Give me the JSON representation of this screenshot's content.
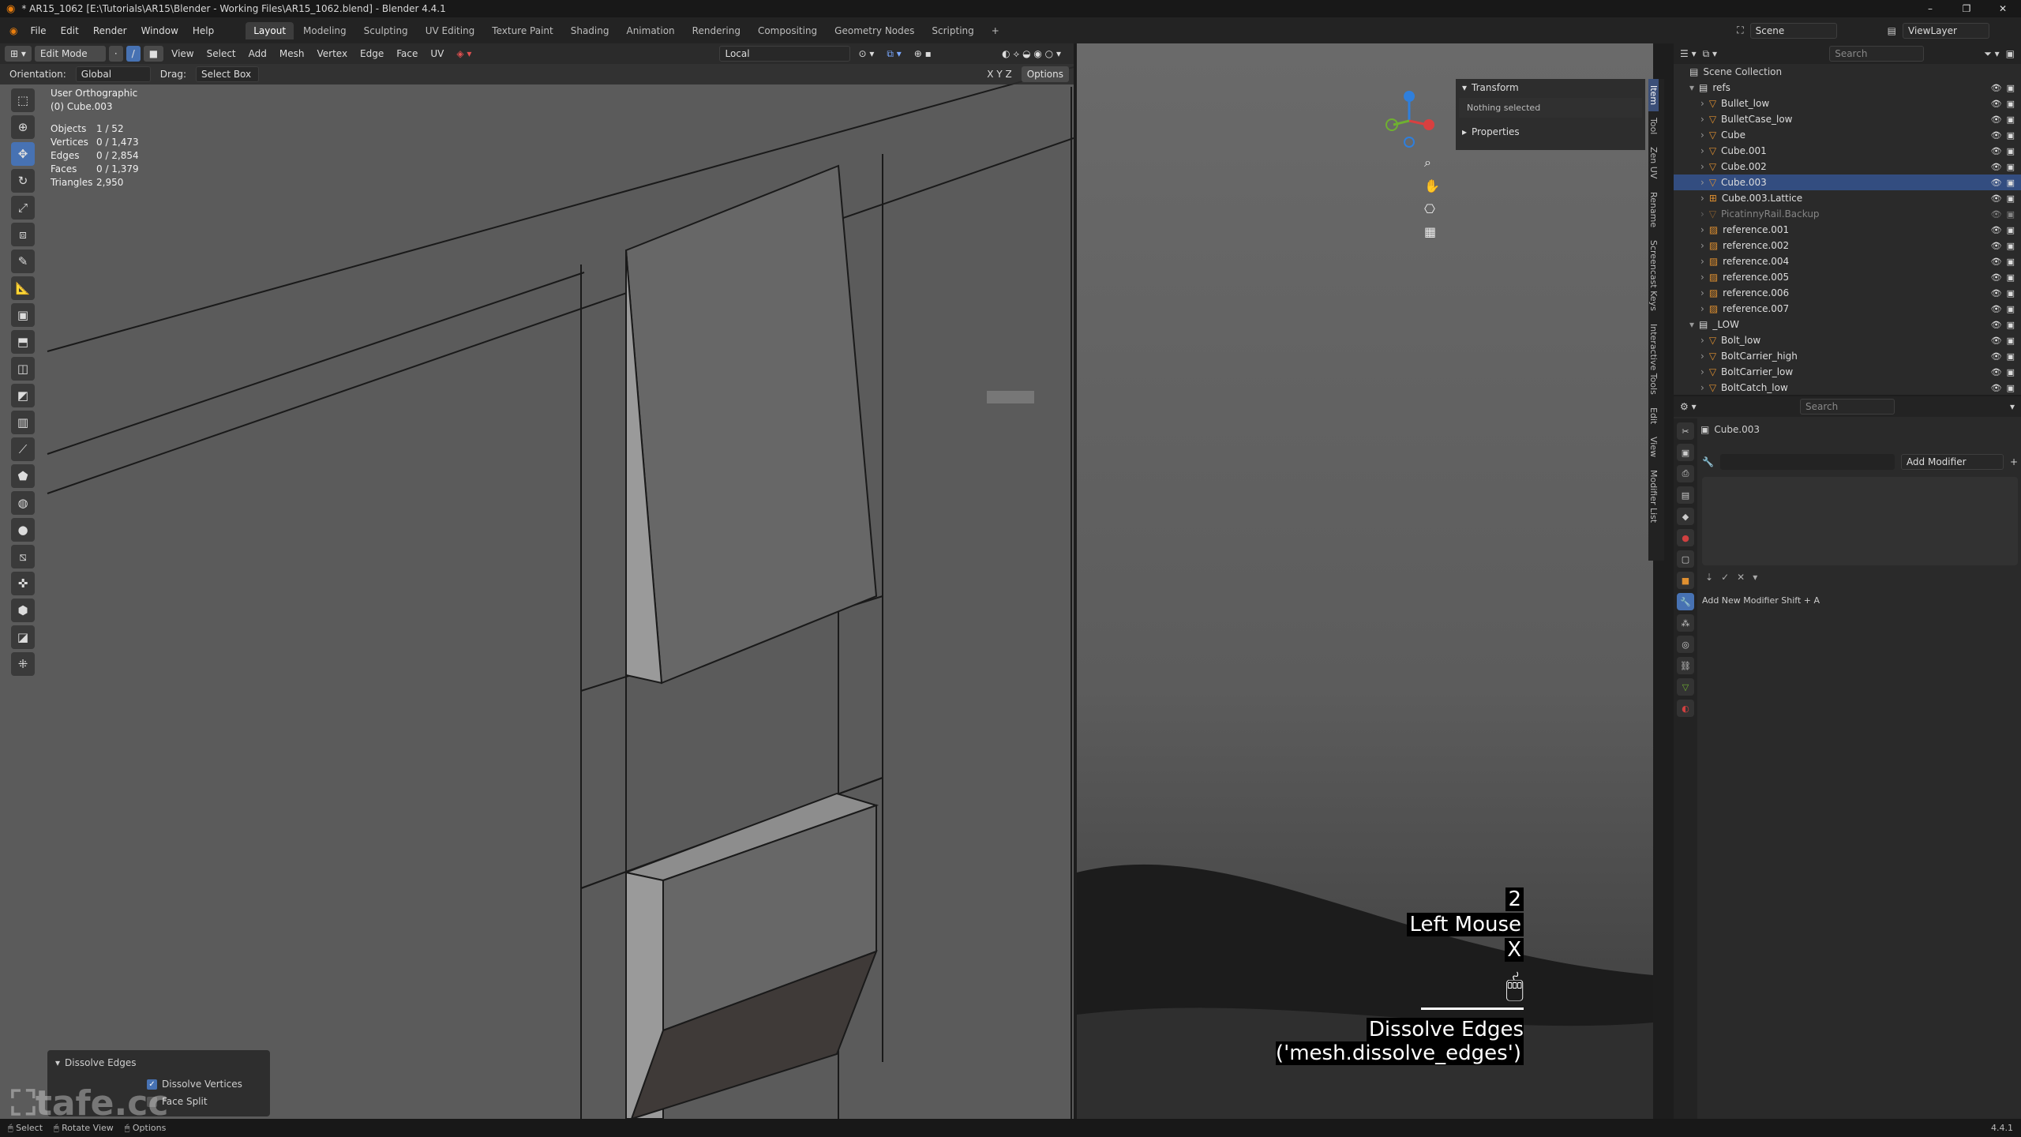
{
  "window": {
    "title": "* AR15_1062 [E:\\Tutorials\\AR15\\Blender - Working Files\\AR15_1062.blend] - Blender 4.4.1",
    "controls": [
      "–",
      "❐",
      "✕"
    ]
  },
  "menubar": {
    "menus": [
      "File",
      "Edit",
      "Render",
      "Window",
      "Help"
    ],
    "workspaces": [
      "Layout",
      "Modeling",
      "Sculpting",
      "UV Editing",
      "Texture Paint",
      "Shading",
      "Animation",
      "Rendering",
      "Compositing",
      "Geometry Nodes",
      "Scripting"
    ],
    "active_workspace": "Layout",
    "scene_label": "Scene",
    "viewlayer_label": "ViewLayer"
  },
  "viewport_header": {
    "mode": "Edit Mode",
    "menus": [
      "View",
      "Select",
      "Add",
      "Mesh",
      "Vertex",
      "Edge",
      "Face",
      "UV"
    ],
    "transform_pivot": "Local",
    "orientation_label": "Orientation:",
    "orientation_value": "Global",
    "drag_label": "Drag:",
    "drag_value": "Select Box"
  },
  "stats": {
    "view_name": "User Orthographic",
    "object_name": "(0) Cube.003",
    "rows": [
      {
        "k": "Objects",
        "v": "1 / 52"
      },
      {
        "k": "Vertices",
        "v": "0 / 1,473"
      },
      {
        "k": "Edges",
        "v": "0 / 2,854"
      },
      {
        "k": "Faces",
        "v": "0 / 1,379"
      },
      {
        "k": "Triangles",
        "v": "2,950"
      }
    ]
  },
  "operator_panel": {
    "title": "Dissolve Edges",
    "options": [
      {
        "label": "Dissolve Vertices",
        "checked": true
      },
      {
        "label": "Face Split",
        "checked": false
      }
    ]
  },
  "npanel": {
    "transform_title": "Transform",
    "nothing_selected": "Nothing selected",
    "properties_title": "Properties",
    "options_label": "Options",
    "tabs": [
      "Item",
      "Tool",
      "View",
      "Edit",
      "Screencast Keys",
      "Interactive Tools",
      "Rename",
      "Zen UV",
      "Modifier List"
    ]
  },
  "key_overlay": {
    "count": "2",
    "mouse": "Left Mouse",
    "key": "X",
    "operator": "Dissolve Edges ('mesh.dissolve_edges')"
  },
  "outliner": {
    "search_placeholder": "Search",
    "root": "Scene Collection",
    "items": [
      {
        "name": "refs",
        "level": 1,
        "kind": "collection"
      },
      {
        "name": "Bullet_low",
        "level": 2,
        "kind": "mesh"
      },
      {
        "name": "BulletCase_low",
        "level": 2,
        "kind": "mesh"
      },
      {
        "name": "Cube",
        "level": 2,
        "kind": "mesh"
      },
      {
        "name": "Cube.001",
        "level": 2,
        "kind": "mesh"
      },
      {
        "name": "Cube.002",
        "level": 2,
        "kind": "mesh"
      },
      {
        "name": "Cube.003",
        "level": 2,
        "kind": "mesh",
        "selected": true
      },
      {
        "name": "Cube.003.Lattice",
        "level": 2,
        "kind": "lattice"
      },
      {
        "name": "PicatinnyRail.Backup",
        "level": 2,
        "kind": "mesh",
        "dim": true
      },
      {
        "name": "reference.001",
        "level": 2,
        "kind": "image"
      },
      {
        "name": "reference.002",
        "level": 2,
        "kind": "image"
      },
      {
        "name": "reference.004",
        "level": 2,
        "kind": "image"
      },
      {
        "name": "reference.005",
        "level": 2,
        "kind": "image"
      },
      {
        "name": "reference.006",
        "level": 2,
        "kind": "image"
      },
      {
        "name": "reference.007",
        "level": 2,
        "kind": "image"
      },
      {
        "name": "_LOW",
        "level": 1,
        "kind": "collection"
      },
      {
        "name": "Bolt_low",
        "level": 2,
        "kind": "mesh"
      },
      {
        "name": "BoltCarrier_high",
        "level": 2,
        "kind": "mesh"
      },
      {
        "name": "BoltCarrier_low",
        "level": 2,
        "kind": "mesh"
      },
      {
        "name": "BoltCatch_low",
        "level": 2,
        "kind": "mesh"
      }
    ]
  },
  "properties": {
    "search_placeholder": "Search",
    "object_name": "Cube.003",
    "add_modifier_label": "Add Modifier",
    "hint": "Add New Modifier Shift + A"
  },
  "statusbar": {
    "items": [
      "Select",
      "Rotate View",
      "Options"
    ],
    "version": "4.4.1"
  },
  "watermark": "tafe.cc",
  "colors": {
    "accent": "#4772b3",
    "selected_row": "#334d80",
    "panel_bg": "#2a2a2a",
    "viewport_bg": "#5a5a5a"
  }
}
